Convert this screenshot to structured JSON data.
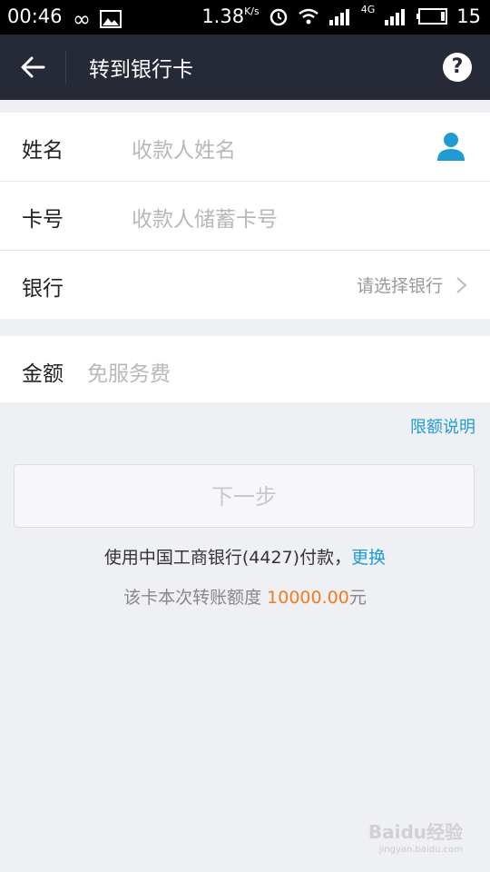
{
  "status_bar": {
    "time": "00:46",
    "speed": "1.38",
    "speed_unit": "K/s",
    "network": "4G",
    "battery": "15"
  },
  "header": {
    "title": "转到银行卡",
    "help_label": "?"
  },
  "form": {
    "name": {
      "label": "姓名",
      "placeholder": "收款人姓名"
    },
    "card": {
      "label": "卡号",
      "placeholder": "收款人储蓄卡号"
    },
    "bank": {
      "label": "银行",
      "value": "请选择银行"
    },
    "amount": {
      "label": "金额",
      "placeholder": "免服务费"
    }
  },
  "limit_link": "限额说明",
  "next_button": "下一步",
  "payment": {
    "prefix": "使用中国工商银行(4427)付款，",
    "change_link": "更换"
  },
  "quota": {
    "prefix": "该卡本次转账额度 ",
    "amount": "10000.00",
    "unit": "元"
  },
  "watermark": {
    "brand": "Baidu经验",
    "url": "jingyan.baidu.com"
  },
  "colors": {
    "header_bg": "#262a36",
    "link": "#1f9bd4",
    "amount": "#f47a1e",
    "page_bg": "#eff0f4"
  }
}
